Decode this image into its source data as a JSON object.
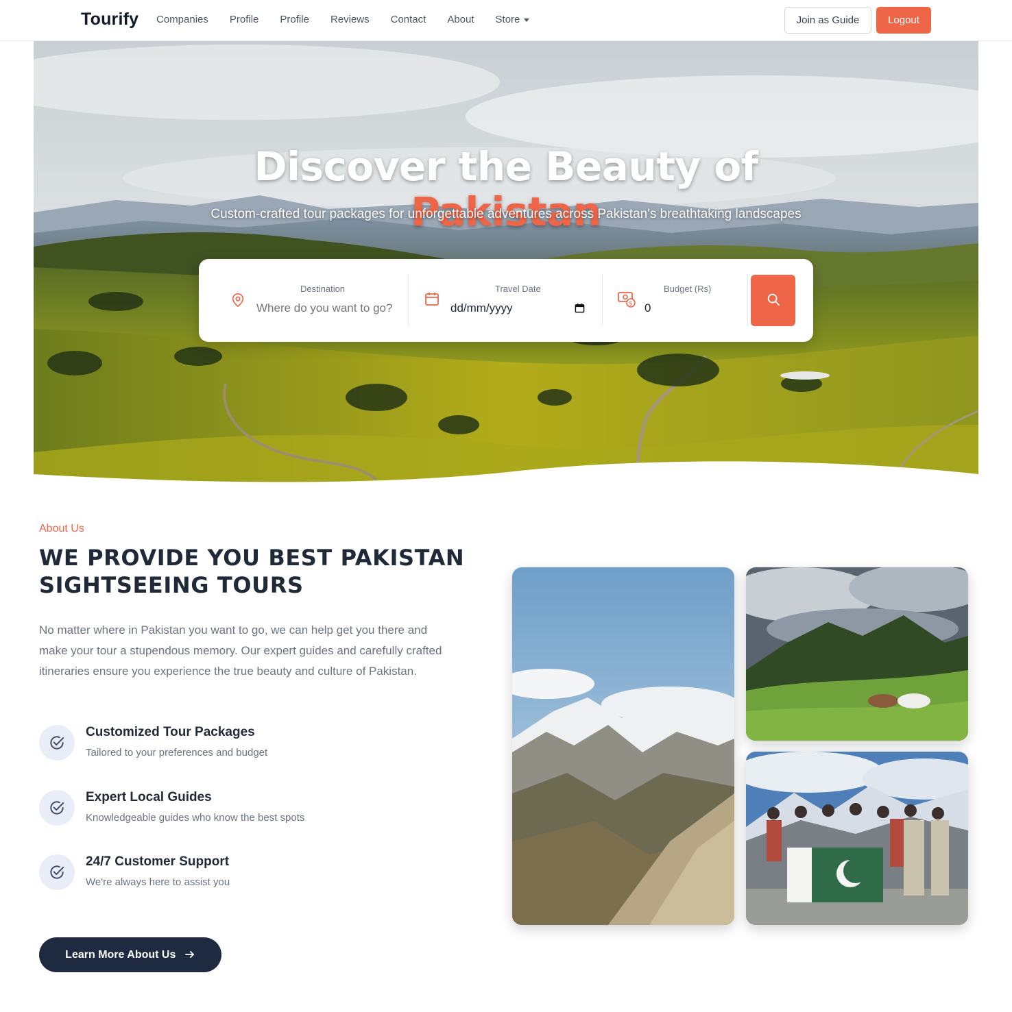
{
  "navbar": {
    "brand": "Tourify",
    "links": [
      "Companies",
      "Profile",
      "Profile",
      "Reviews",
      "Contact",
      "About",
      "Store"
    ],
    "join_label": "Join as Guide",
    "logout_label": "Logout"
  },
  "hero": {
    "title_line1": "Discover the Beauty of",
    "title_line2": "Pakistan",
    "subtitle": "Custom-crafted tour packages for unforgettable adventures across Pakistan's breathtaking landscapes"
  },
  "search": {
    "destination_label": "Destination",
    "destination_placeholder": "Where do you want to go?",
    "date_label": "Travel Date",
    "date_placeholder": "dd/mm/yyyy",
    "budget_label": "Budget (Rs)",
    "budget_value": "0"
  },
  "about": {
    "tag": "About Us",
    "heading_line1": "WE PROVIDE YOU BEST PAKISTAN",
    "heading_line2": "SIGHTSEEING TOURS",
    "text": "No matter where in Pakistan you want to go, we can help get you there and make your tour a stupendous memory. Our expert guides and carefully crafted itineraries ensure you experience the true beauty and culture of Pakistan.",
    "features": [
      {
        "title": "Customized Tour Packages",
        "desc": "Tailored to your preferences and budget"
      },
      {
        "title": "Expert Local Guides",
        "desc": "Knowledgeable guides who know the best spots"
      },
      {
        "title": "24/7 Customer Support",
        "desc": "We're always here to assist you"
      }
    ],
    "button_label": "Learn More About Us"
  },
  "colors": {
    "accent": "#ee6548",
    "dark": "#1e2a3f"
  },
  "icons": {
    "destination": "map-pin-icon",
    "date": "calendar-icon",
    "budget": "money-icon",
    "search": "search-icon",
    "feature": "check-circle-icon",
    "button": "arrow-right-icon"
  }
}
